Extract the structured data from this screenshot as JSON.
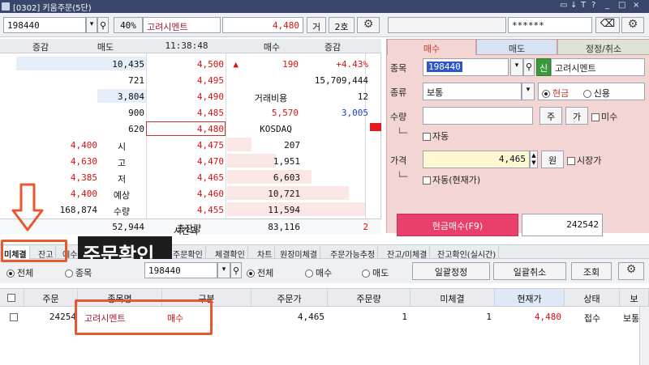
{
  "titlebar": {
    "title": "[0302] 키움주문(5단)",
    "controls": [
      "▭",
      "↓",
      "T",
      "?",
      "_",
      "□",
      "×"
    ]
  },
  "topbar": {
    "code": "198440",
    "margin": "40%",
    "name": "고려시멘트",
    "price": "4,480",
    "btn_exchange": "거",
    "btn_quote": "2호",
    "password": "******"
  },
  "orderbook": {
    "headers": {
      "change_left": "증감",
      "sell": "매도",
      "time": "11:38:48",
      "buy": "매수",
      "change_right": "증감"
    },
    "ask_rows": [
      {
        "qty": "10,435",
        "price": "4,500",
        "mark": "▲",
        "extra1": "190",
        "extra2": "+4.43%"
      },
      {
        "qty": "721",
        "price": "4,495",
        "extra1": "",
        "extra2": "15,709,444"
      },
      {
        "qty": "3,804",
        "price": "4,490",
        "extra1": "거래비용",
        "extra2": "12"
      },
      {
        "qty": "900",
        "price": "4,485",
        "extra1": "5,570",
        "extra2": "3,005"
      },
      {
        "qty": "620",
        "price": "4,480",
        "extra1": "KOSDAQ",
        "extra2": ""
      }
    ],
    "bid_rows": [
      {
        "left": "4,400",
        "label": "시",
        "price": "4,475",
        "qty": "207"
      },
      {
        "left": "4,630",
        "label": "고",
        "price": "4,470",
        "qty": "1,951"
      },
      {
        "left": "4,385",
        "label": "저",
        "price": "4,465",
        "qty": "6,603"
      },
      {
        "left": "4,400",
        "label": "예상",
        "price": "4,460",
        "qty": "10,721"
      },
      {
        "left": "168,874",
        "label": "수량",
        "price": "4,455",
        "qty": "11,594"
      }
    ],
    "totals": {
      "sell_total": "52,944",
      "label": "총잔량",
      "buy_total": "83,116",
      "diff": "2"
    },
    "after_hours": "시간외"
  },
  "order_panel": {
    "tabs": [
      "매수",
      "매도",
      "정정/취소"
    ],
    "labels": {
      "code": "종목",
      "type": "종류",
      "qty": "수량",
      "price": "가격"
    },
    "code": "198440",
    "badge": "신",
    "name": "고려시멘트",
    "order_type": "보통",
    "radio_cash": "현금",
    "radio_credit": "신용",
    "btn_ju": "주",
    "btn_ga": "가",
    "chk_misu": "미수",
    "chk_auto": "자동",
    "price": "4,465",
    "btn_won": "원",
    "chk_market": "시장가",
    "chk_auto_cur": "자동(현재가)",
    "submit": "현금매수(F9)",
    "max_qty": "242542"
  },
  "bottom_tabs": [
    "미체결",
    "잔고",
    "예수",
    "주문확인",
    "체결확인",
    "차트",
    "원장미체결",
    "주문가능추정",
    "잔고/미체결",
    "잔고확인(실시간)"
  ],
  "annotation_text": "주문확인",
  "filter": {
    "radio_all": "전체",
    "radio_stock": "종목",
    "code": "198440",
    "radio_all2": "전체",
    "radio_buy": "매수",
    "radio_sell": "매도",
    "btn_bulk_edit": "일괄정정",
    "btn_bulk_cancel": "일괄취소",
    "btn_lookup": "조회"
  },
  "grid": {
    "headers": [
      "주문",
      "종목명",
      "구분",
      "주문가",
      "주문량",
      "미체결",
      "현재가",
      "상태",
      "보"
    ],
    "rows": [
      [
        "24254",
        "고려시멘트",
        "매수",
        "4,465",
        "1",
        "1",
        "4,480",
        "접수",
        "보통"
      ]
    ]
  }
}
